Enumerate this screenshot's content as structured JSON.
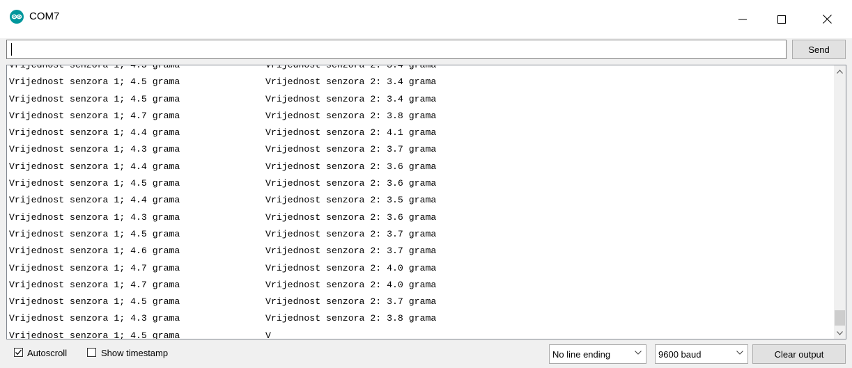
{
  "window": {
    "title": "COM7"
  },
  "input": {
    "value": "",
    "send_label": "Send"
  },
  "output": {
    "lines": [
      {
        "s1": "Vrijednost senzora 1; 4.5 grama",
        "s2": "Vrijednost senzora 2: 3.4 grama"
      },
      {
        "s1": "Vrijednost senzora 1; 4.5 grama",
        "s2": "Vrijednost senzora 2: 3.4 grama"
      },
      {
        "s1": "Vrijednost senzora 1; 4.5 grama",
        "s2": "Vrijednost senzora 2: 3.4 grama"
      },
      {
        "s1": "Vrijednost senzora 1; 4.7 grama",
        "s2": "Vrijednost senzora 2: 3.8 grama"
      },
      {
        "s1": "Vrijednost senzora 1; 4.4 grama",
        "s2": "Vrijednost senzora 2: 4.1 grama"
      },
      {
        "s1": "Vrijednost senzora 1; 4.3 grama",
        "s2": "Vrijednost senzora 2: 3.7 grama"
      },
      {
        "s1": "Vrijednost senzora 1; 4.4 grama",
        "s2": "Vrijednost senzora 2: 3.6 grama"
      },
      {
        "s1": "Vrijednost senzora 1; 4.5 grama",
        "s2": "Vrijednost senzora 2: 3.6 grama"
      },
      {
        "s1": "Vrijednost senzora 1; 4.4 grama",
        "s2": "Vrijednost senzora 2: 3.5 grama"
      },
      {
        "s1": "Vrijednost senzora 1; 4.3 grama",
        "s2": "Vrijednost senzora 2: 3.6 grama"
      },
      {
        "s1": "Vrijednost senzora 1; 4.5 grama",
        "s2": "Vrijednost senzora 2: 3.7 grama"
      },
      {
        "s1": "Vrijednost senzora 1; 4.6 grama",
        "s2": "Vrijednost senzora 2: 3.7 grama"
      },
      {
        "s1": "Vrijednost senzora 1; 4.7 grama",
        "s2": "Vrijednost senzora 2: 4.0 grama"
      },
      {
        "s1": "Vrijednost senzora 1; 4.7 grama",
        "s2": "Vrijednost senzora 2: 4.0 grama"
      },
      {
        "s1": "Vrijednost senzora 1; 4.5 grama",
        "s2": "Vrijednost senzora 2: 3.7 grama"
      },
      {
        "s1": "Vrijednost senzora 1; 4.3 grama",
        "s2": "Vrijednost senzora 2: 3.8 grama"
      },
      {
        "s1": "Vrijednost senzora 1; 4.5 grama",
        "s2": "V"
      }
    ]
  },
  "footer": {
    "autoscroll_label": "Autoscroll",
    "autoscroll_checked": true,
    "timestamp_label": "Show timestamp",
    "timestamp_checked": false,
    "line_ending": "No line ending",
    "baud": "9600 baud",
    "clear_label": "Clear output"
  },
  "icons": {
    "app": "arduino-icon",
    "minimize": "minimize-icon",
    "maximize": "maximize-icon",
    "close": "close-icon"
  },
  "colors": {
    "accent": "#00979c"
  }
}
